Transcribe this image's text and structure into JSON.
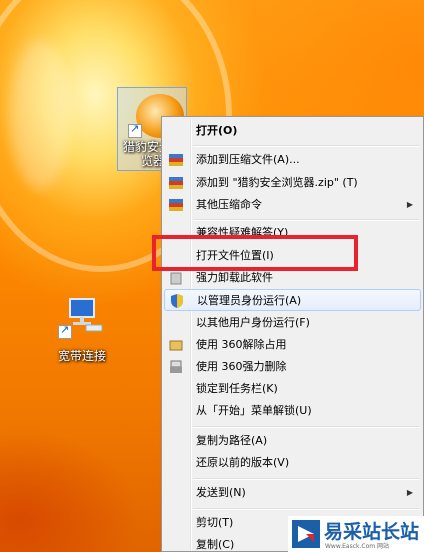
{
  "desktop": {
    "app_icon_label": "猎豹安全浏览器",
    "net_icon_label": "宽带连接"
  },
  "context_menu": {
    "items": [
      {
        "label": "打开(O)",
        "bold": true
      },
      {
        "label": "添加到压缩文件(A)...",
        "icon": "archive-icon"
      },
      {
        "label": "添加到 \"猎豹安全浏览器.zip\" (T)",
        "icon": "archive-icon"
      },
      {
        "label": "其他压缩命令",
        "icon": "archive-icon",
        "submenu": true
      },
      {
        "label": "兼容性疑难解答(Y)"
      },
      {
        "label": "打开文件位置(I)"
      },
      {
        "label": "强力卸载此软件",
        "icon": "uninstall-icon"
      },
      {
        "label": "以管理员身份运行(A)",
        "icon": "uac-shield-icon"
      },
      {
        "label": "以其他用户身份运行(F)"
      },
      {
        "label": "使用 360解除占用",
        "icon": "360-unlock-icon"
      },
      {
        "label": "使用 360强力删除",
        "icon": "360-shred-icon"
      },
      {
        "label": "锁定到任务栏(K)"
      },
      {
        "label": "从「开始」菜单解锁(U)"
      },
      {
        "label": "复制为路径(A)"
      },
      {
        "label": "还原以前的版本(V)"
      },
      {
        "label": "发送到(N)",
        "submenu": true
      },
      {
        "label": "剪切(T)"
      },
      {
        "label": "复制(C)"
      }
    ]
  },
  "watermark": {
    "title": "易采站长站",
    "url": "Www.Easck.Com 网站"
  },
  "colors": {
    "highlight_box": "#e8232d",
    "menu_bg": "#f0f0f0",
    "menu_hover_border": "#aecff7",
    "watermark_blue": "#1a5fa8"
  }
}
